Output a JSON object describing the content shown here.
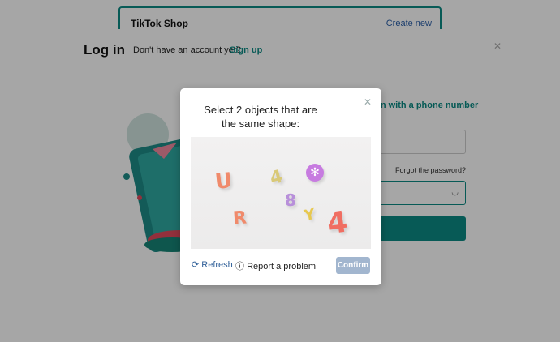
{
  "background": {
    "shop_title": "TikTok Shop",
    "create_link": "Create new",
    "login_title": "Log in",
    "no_account_text": "Don't have an account yet?",
    "signup_link": "Sign up",
    "phone_login_link": "g in with a phone number",
    "forgot_password": "Forgot the password?",
    "accent_color": "#0b8a84"
  },
  "captcha": {
    "prompt": "Select 2 objects that are the same shape:",
    "objects": [
      "U",
      "4",
      "✻",
      "8",
      "R",
      "Y",
      "4"
    ],
    "refresh_label": "Refresh",
    "report_label": "Report a problem",
    "confirm_label": "Confirm",
    "icons": {
      "close": "close-icon",
      "refresh": "refresh-icon",
      "report": "info-icon"
    }
  }
}
